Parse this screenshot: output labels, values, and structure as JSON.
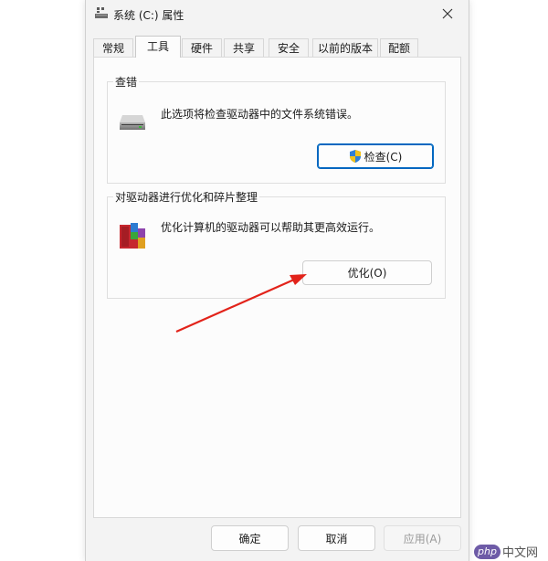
{
  "window": {
    "title": "系统 (C:) 属性"
  },
  "tabs": [
    {
      "label": "常规"
    },
    {
      "label": "工具"
    },
    {
      "label": "硬件"
    },
    {
      "label": "共享"
    },
    {
      "label": "安全"
    },
    {
      "label": "以前的版本"
    },
    {
      "label": "配额"
    }
  ],
  "active_tab": "工具",
  "error_check": {
    "title": "查错",
    "description": "此选项将检查驱动器中的文件系统错误。",
    "button": "检查(C)"
  },
  "optimize": {
    "title": "对驱动器进行优化和碎片整理",
    "description": "优化计算机的驱动器可以帮助其更高效运行。",
    "button": "优化(O)"
  },
  "footer": {
    "ok": "确定",
    "cancel": "取消",
    "apply": "应用(A)"
  },
  "watermark": {
    "brand": "php",
    "site": "中文网"
  },
  "colors": {
    "accent": "#0067c0",
    "arrow": "#e2231a"
  }
}
